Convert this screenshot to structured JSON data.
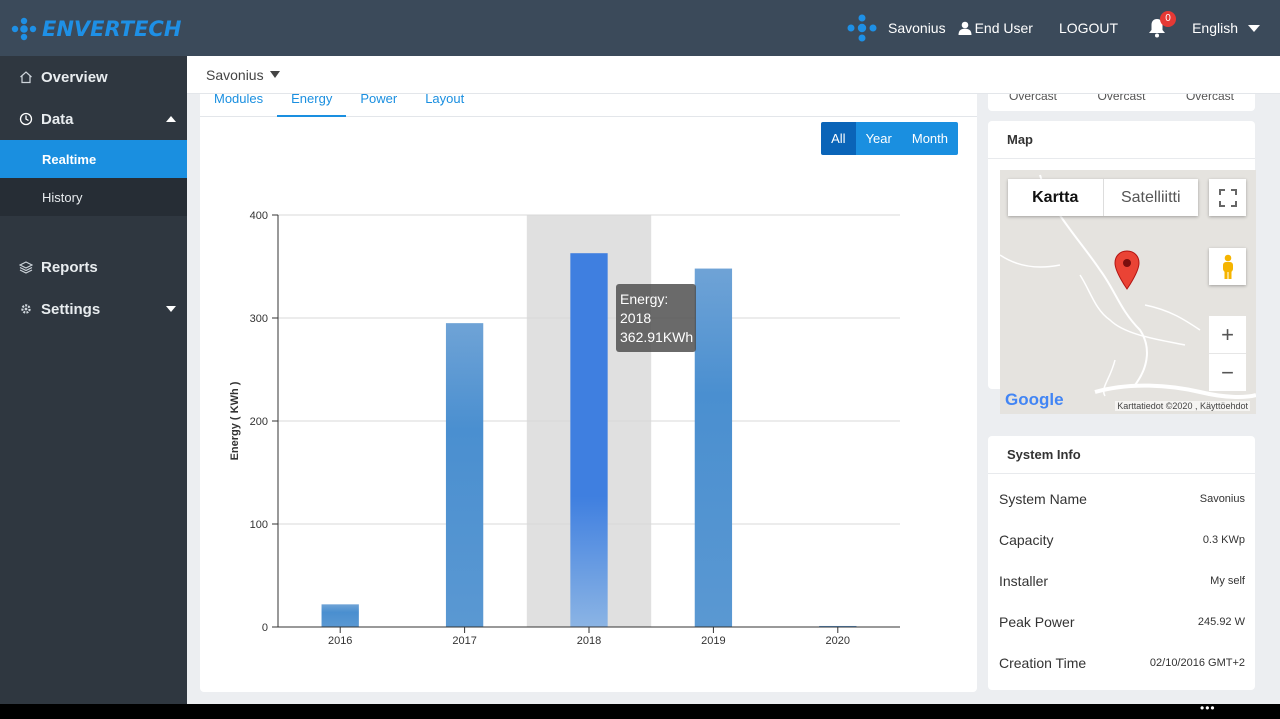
{
  "header": {
    "logo_text": "ENVERTECH",
    "site_name": "Savonius",
    "user_label": "End User",
    "logout_label": "LOGOUT",
    "notification_count": "0",
    "language": "English"
  },
  "sidebar": {
    "items": [
      {
        "label": "Overview"
      },
      {
        "label": "Data"
      },
      {
        "label": "Realtime"
      },
      {
        "label": "History"
      },
      {
        "label": "Reports"
      },
      {
        "label": "Settings"
      }
    ]
  },
  "site_selector": {
    "value": "Savonius"
  },
  "tabs": [
    {
      "label": "Modules"
    },
    {
      "label": "Energy"
    },
    {
      "label": "Power"
    },
    {
      "label": "Layout"
    }
  ],
  "range_buttons": [
    {
      "label": "All"
    },
    {
      "label": "Year"
    },
    {
      "label": "Month"
    }
  ],
  "tooltip": {
    "line1": "Energy:",
    "line2": "2018",
    "line3": "362.91KWh"
  },
  "chart_data": {
    "type": "bar",
    "categories": [
      "2016",
      "2017",
      "2018",
      "2019",
      "2020"
    ],
    "values": [
      22,
      295,
      362.91,
      348,
      1
    ],
    "ylabel": "Energy ( KWh )",
    "xlabel": "",
    "ylim": [
      0,
      400
    ],
    "yticks": [
      "0",
      "100",
      "200",
      "300",
      "400"
    ],
    "highlight_category": "2018",
    "bar_color": "#4a8fd0",
    "highlight_color": "#3f7fe0",
    "grid": true
  },
  "weather": {
    "items": [
      "Overcast",
      "Overcast",
      "Overcast"
    ]
  },
  "map": {
    "title": "Map",
    "type_map": "Kartta",
    "type_satellite": "Satelliitti",
    "google_label": "Google",
    "attribution": "Karttatiedot ©2020 , Käyttöehdot",
    "zoom_in": "+",
    "zoom_out": "−"
  },
  "system_info": {
    "title": "System Info",
    "rows": [
      {
        "key": "System Name",
        "value": "Savonius"
      },
      {
        "key": "Capacity",
        "value": "0.3 KWp"
      },
      {
        "key": "Installer",
        "value": "My self"
      },
      {
        "key": "Peak Power",
        "value": "245.92 W"
      },
      {
        "key": "Creation Time",
        "value": "02/10/2016 GMT+2"
      }
    ]
  },
  "colors": {
    "topbar": "#3b4a5a",
    "sidebar": "#2f3740",
    "accent": "#1a8fe0"
  }
}
